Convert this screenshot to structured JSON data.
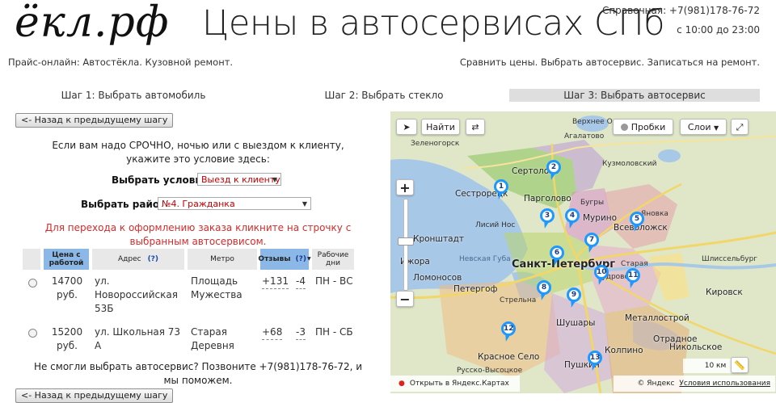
{
  "header": {
    "logo": "ёкл.рф",
    "title": "Цены в автосервисах СПб",
    "phone": "Справочная: +7(981)178-76-72",
    "hours": "с 10:00 до 23:00",
    "subtitle_left": "Прайс-онлайн: Автостёкла. Кузовной ремонт.",
    "subtitle_right": "Сравнить цены. Выбрать автосервис. Записаться на ремонт."
  },
  "steps": [
    {
      "label": "Шаг 1: Выбрать автомобиль",
      "active": false
    },
    {
      "label": "Шаг 2: Выбрать стекло",
      "active": false
    },
    {
      "label": "Шаг 3: Выбрать автосервис",
      "active": true
    }
  ],
  "back_button": "<- Назад к предыдущему шагу",
  "urgent_note": "Если вам надо СРОЧНО, ночью или с выездом к клиенту, укажите это условие здесь:",
  "condition": {
    "label": "Выбрать условие:",
    "value": "Выезд к клиенту"
  },
  "district": {
    "label": "Выбрать район:",
    "value": "№4. Гражданка"
  },
  "order_note": "Для перехода к оформлению заказа кликните на строчку с выбранным автосервисом.",
  "table": {
    "headers": {
      "price": "Цена с работой",
      "address": "Адрес",
      "address_help": "(?)",
      "metro": "Метро",
      "reviews": "Отзывы",
      "reviews_help": "(?)",
      "hours": "Рабочие дни"
    },
    "rows": [
      {
        "price": "14700 руб.",
        "address": "ул. Новороссийская 53Б",
        "metro": "Площадь Мужества",
        "reviews_pos": "+131",
        "reviews_neg": "-4",
        "days": "ПН - ВС"
      },
      {
        "price": "15200 руб.",
        "address": "ул. Школьная 73 А",
        "metro": "Старая Деревня",
        "reviews_pos": "+68",
        "reviews_neg": "-3",
        "days": "ПН - СБ"
      }
    ]
  },
  "footer_note": "Не смогли выбрать автосервис? Позвоните +7(981)178-76-72, и мы поможем.",
  "map": {
    "find_button": "Найти",
    "traffic_button": "Пробки",
    "layers_button": "Слои",
    "attribution_open": "Открыть в Яндекс.Картах",
    "attribution_yandex": "© Яндекс",
    "terms_link": "Условия использования",
    "scale": "10 км",
    "labels": {
      "verkhneye": "Верхнее Осельки",
      "agalatovo": "Агалатово",
      "zelenogorsk": "Зеленогорск",
      "sertolovo": "Сертолово",
      "kuzmolovo": "Кузмоловский",
      "sestroretsk": "Сестрорецк",
      "pargolovo": "Парголово",
      "bugry": "Бугры",
      "lisiy": "Лисий Нос",
      "murino": "Мурино",
      "vsevolozhsk": "Всеволожск",
      "yanino": "Яновка",
      "kronstadt": "Кронштадт",
      "nevskaya": "Невская Губа",
      "izhora": "Ижора",
      "spb": "Санкт-Петербург",
      "kudrovo": "Кудрово",
      "staraya": "Старая",
      "shlisselburg": "Шлиссельбург",
      "lomonosov": "Ломоносов",
      "petergof": "Петергоф",
      "strelna": "Стрельна",
      "kirovsk": "Кировск",
      "shushary": "Шушары",
      "metallostroy": "Металлострой",
      "otradnoe": "Отрадное",
      "krasnoe": "Красное Село",
      "kolpino": "Колпино",
      "nikolskoe": "Никольское",
      "pushkin": "Пушкин",
      "russko": "Русско-Высоцкое"
    },
    "pins": [
      "1",
      "2",
      "3",
      "4",
      "5",
      "6",
      "7",
      "8",
      "9",
      "10",
      "11",
      "12",
      "13"
    ]
  }
}
